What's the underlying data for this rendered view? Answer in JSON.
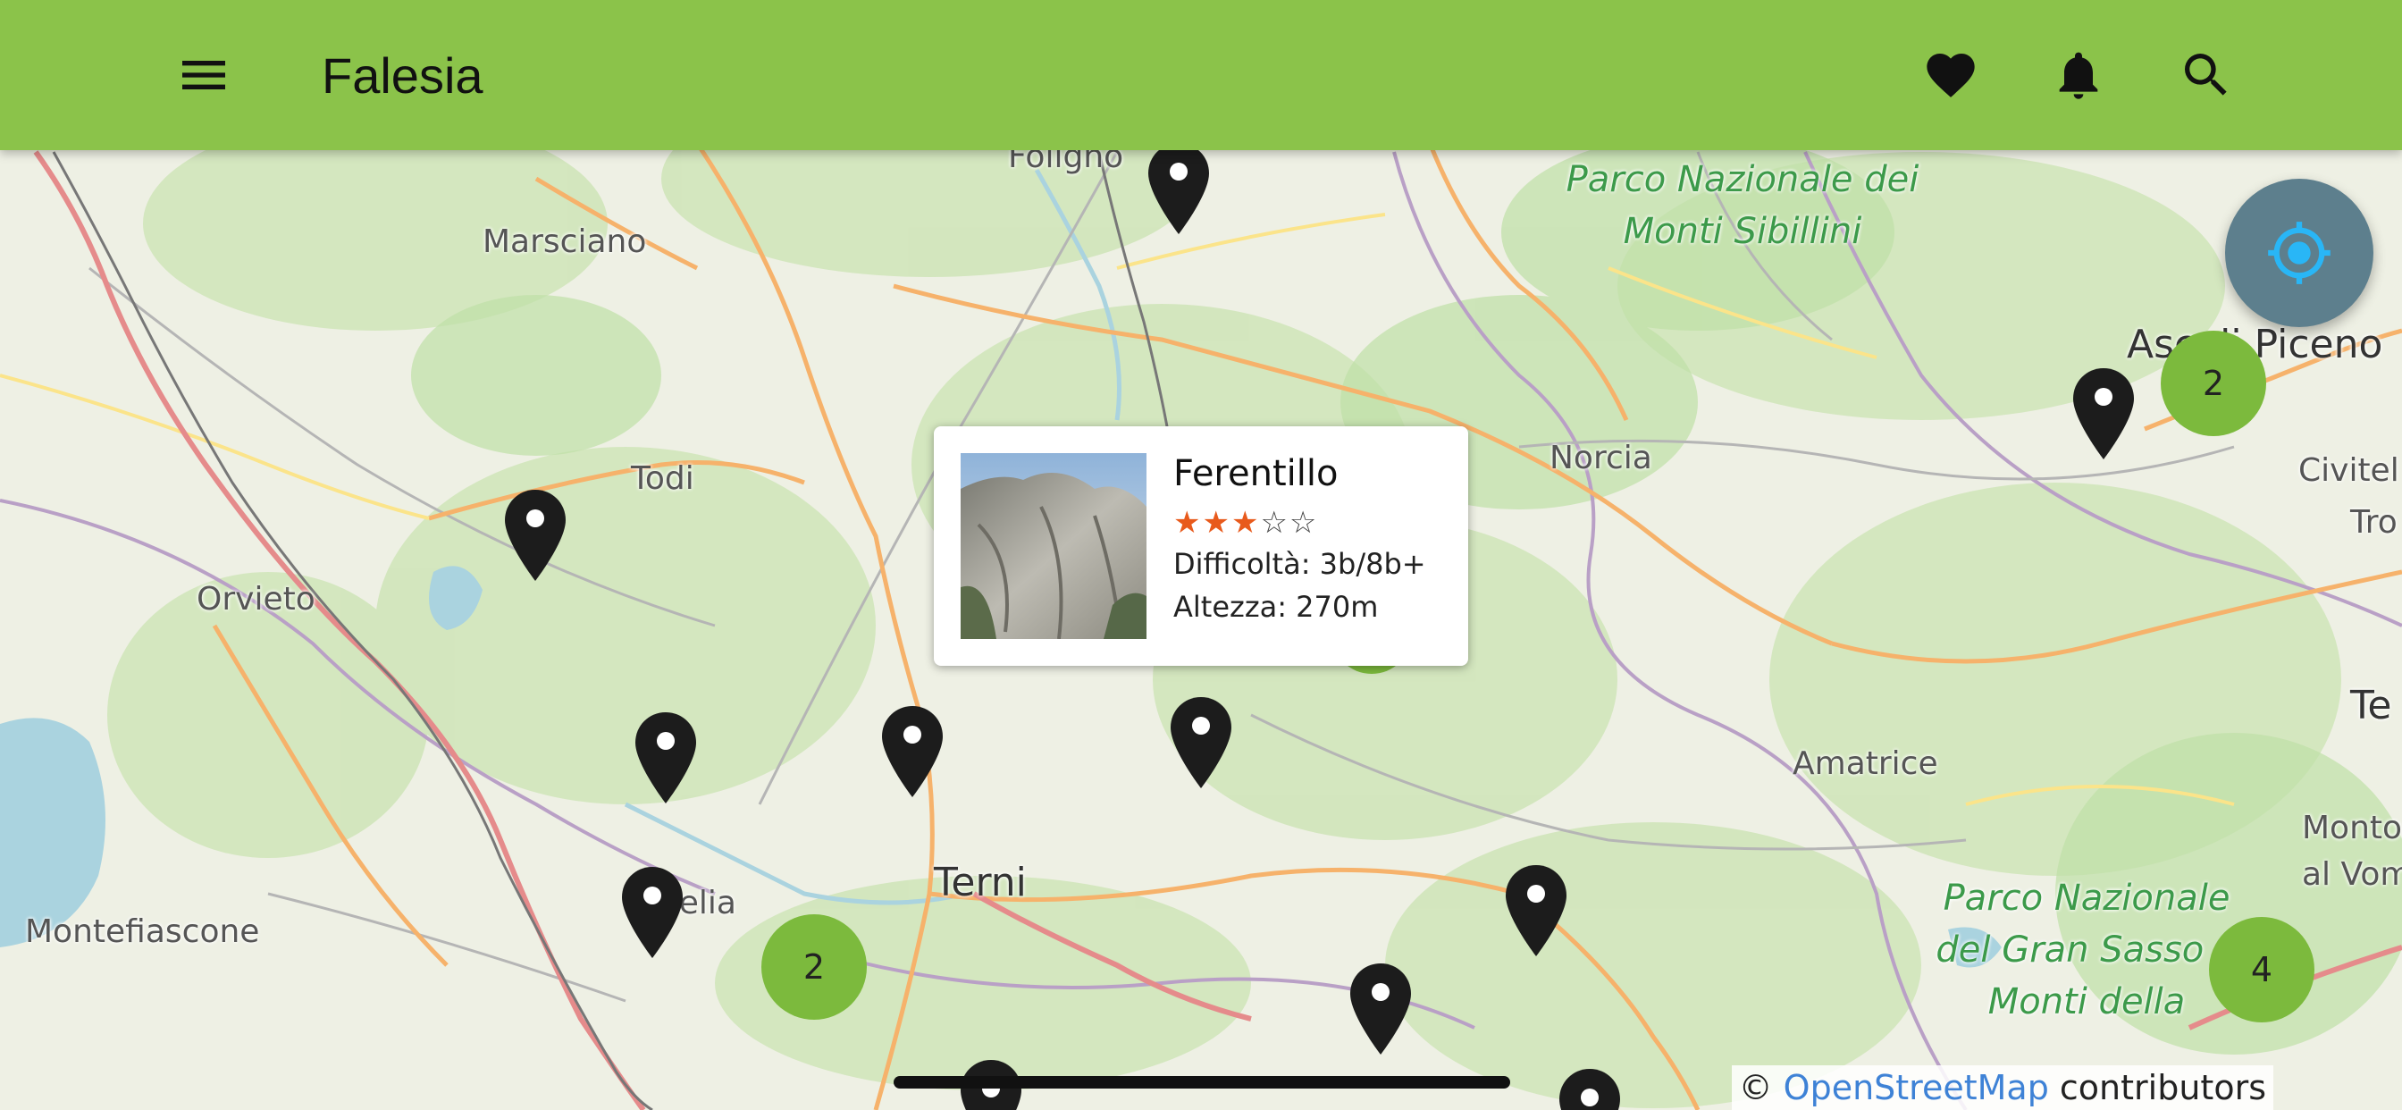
{
  "app": {
    "title": "Falesia",
    "colors": {
      "appbar": "#8bc34a",
      "cluster": "#7cba3d",
      "fab": "#5d7f8d",
      "fab_icon": "#29b6f6",
      "star": "#e85a1c",
      "link": "#3e82d6"
    },
    "icons": {
      "menu": "menu-icon",
      "favorites": "heart-icon",
      "notifications": "bell-icon",
      "search": "search-icon",
      "locate": "crosshair-icon"
    }
  },
  "map": {
    "labels": {
      "foligno": "Foligno",
      "marsciano": "Marsciano",
      "todi": "Todi",
      "orvieto": "Orvieto",
      "norcia": "Norcia",
      "ascoli": "Ascoli Piceno",
      "civitella": "Civitel",
      "tro": "Tro",
      "te": "Te",
      "amatrice": "Amatrice",
      "terni": "Terni",
      "amelia": "Amelia",
      "montefiascone": "Montefiascone",
      "montorio": "Montori",
      "al_vomano": "al Vomar",
      "park_sibillini": "Parco Nazionale dei Monti Sibillini",
      "park_gran_sasso": "Parco Nazionale del Gran Sasso e Monti della"
    },
    "clusters": [
      {
        "count": "2"
      },
      {
        "count": "2"
      },
      {
        "count": "4"
      }
    ]
  },
  "popup": {
    "name": "Ferentillo",
    "rating": 3,
    "rating_max": 5,
    "stars_on": "★★★",
    "stars_off": "☆☆",
    "difficulty": "Difficoltà: 3b/8b+",
    "height": "Altezza: 270m"
  },
  "attribution": {
    "prefix": "© ",
    "link": "OpenStreetMap",
    "suffix": " contributors"
  }
}
